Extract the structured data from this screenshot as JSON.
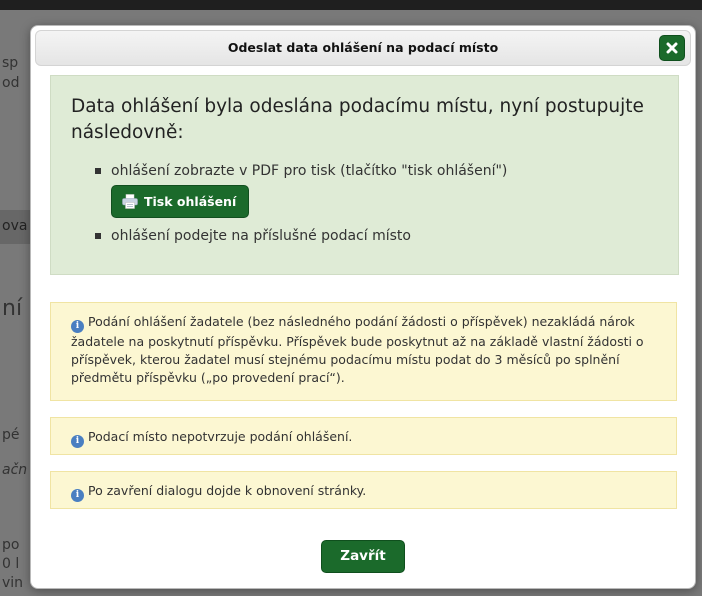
{
  "background": {
    "fragments": [
      "sp",
      "od",
      "ova",
      "ní",
      "pé",
      "ačn",
      "po",
      "0 l",
      "vin"
    ]
  },
  "dialog": {
    "title": "Odeslat data ohlášení na podací místo",
    "close_icon": "close-icon",
    "success": {
      "heading": "Data ohlášení byla odeslána podacímu místu, nyní postupujte následovně:",
      "steps": [
        "ohlášení zobrazte v PDF pro tisk (tlačítko \"tisk ohlášení\")",
        "ohlášení podejte na příslušné podací místo"
      ],
      "print_button": "Tisk ohlášení",
      "print_icon": "printer-icon"
    },
    "info_icon": "info-icon",
    "notices": [
      "Podání ohlášení žadatele (bez následného podání žádosti o příspěvek) nezakládá nárok žadatele na poskytnutí příspěvku. Příspěvek bude poskytnut až na základě vlastní žádosti o příspěvek, kterou žadatel musí stejnému podacímu místu podat do 3 měsíců po splnění předmětu příspěvku („po provedení prací“).",
      "Podací místo nepotvrzuje podání ohlášení.",
      "Po zavření dialogu dojde k obnovení stránky."
    ],
    "close_button": "Zavřít"
  },
  "colors": {
    "primary_green": "#1b6a2b",
    "success_bg": "#dfebd6",
    "notice_bg": "#fcf7d2",
    "info_blue": "#4a7fc1"
  }
}
